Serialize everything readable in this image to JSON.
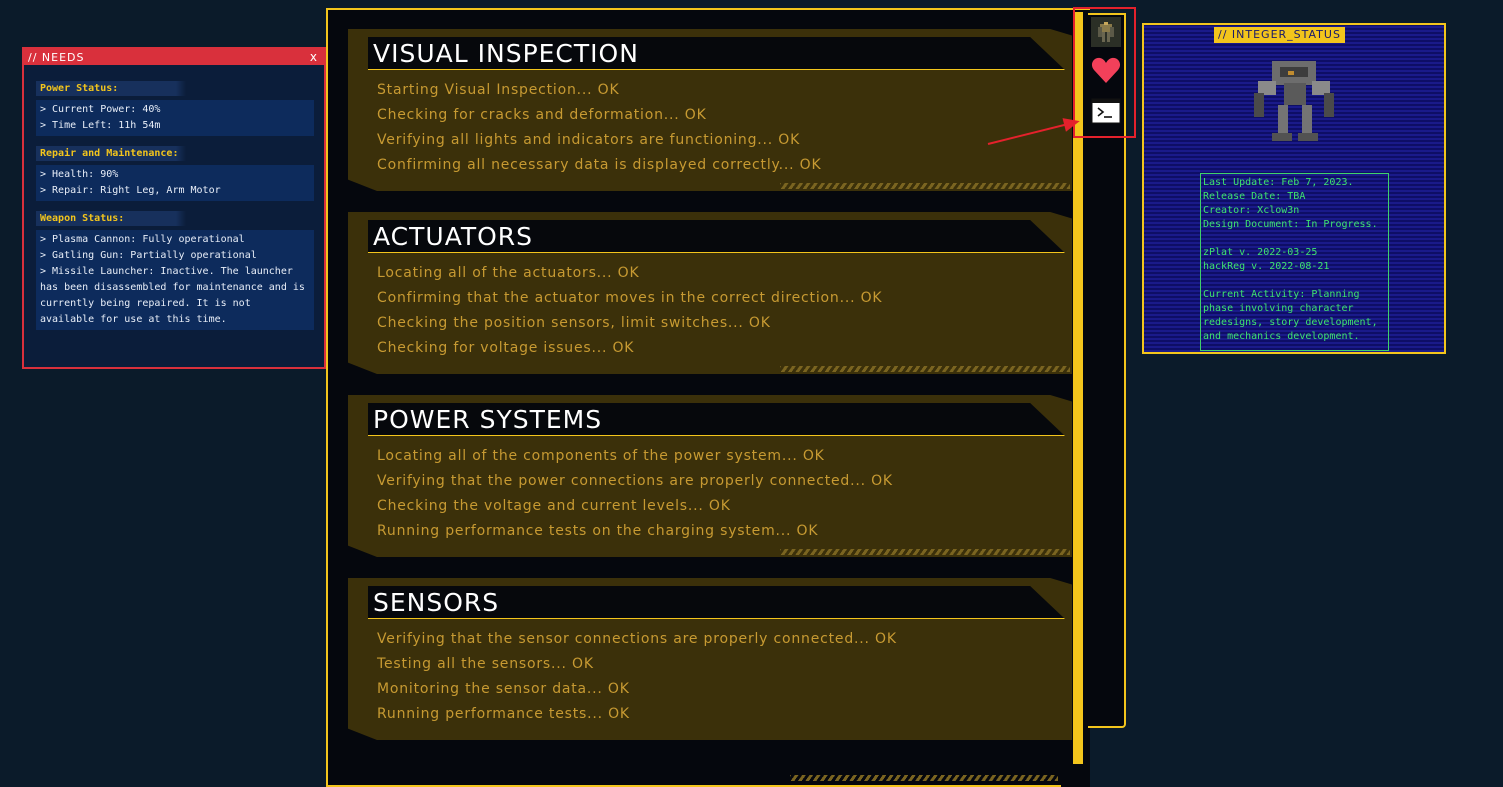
{
  "needs": {
    "title": "// NEEDS",
    "close": "x",
    "sections": [
      {
        "title": "Power Status:",
        "lines": [
          "> Current Power: 40%",
          "> Time Left: 11h 54m"
        ]
      },
      {
        "title": "Repair and Maintenance:",
        "lines": [
          "> Health: 90%",
          "> Repair: Right Leg, Arm Motor"
        ]
      },
      {
        "title": "Weapon Status:",
        "lines": [
          "> Plasma Cannon: Fully operational",
          "> Gatling Gun: Partially operational",
          "> Missile Launcher: Inactive. The launcher has been disassembled for maintenance and is currently being repaired. It is not available for use at this time."
        ]
      }
    ]
  },
  "checklist": [
    {
      "title": "VISUAL INSPECTION",
      "lines": [
        "Starting Visual Inspection... OK",
        "Checking for cracks and deformation... OK",
        "Verifying all lights and indicators are functioning... OK",
        "Confirming all necessary data is displayed correctly... OK"
      ]
    },
    {
      "title": "ACTUATORS",
      "lines": [
        "Locating all of the actuators... OK",
        "Confirming that the actuator moves in the correct direction... OK",
        "Checking the position sensors, limit switches... OK",
        "Checking for voltage issues... OK"
      ]
    },
    {
      "title": "POWER SYSTEMS",
      "lines": [
        "Locating all of the components of the power system... OK",
        "Verifying that the power connections are properly connected... OK",
        "Checking the voltage and current levels... OK",
        "Running performance tests on the charging system... OK"
      ]
    },
    {
      "title": "SENSORS",
      "lines": [
        "Verifying that the sensor connections are properly connected... OK",
        "Testing all the sensors... OK",
        "Monitoring the sensor data... OK",
        "Running performance tests... OK"
      ]
    }
  ],
  "toolbar": {
    "icons": [
      "mech-avatar-icon",
      "heart-icon",
      "terminal-icon"
    ]
  },
  "status": {
    "badge": "// INTEGER_STATUS",
    "info": [
      "Last Update: Feb 7, 2023.",
      "Release Date: TBA",
      "Creator: Xclow3n",
      "Design Document: In Progress.",
      "",
      "zPlat v. 2022-03-25",
      "hackReg v. 2022-08-21",
      "",
      "Current Activity: Planning phase involving character redesigns, story development, and mechanics development."
    ]
  },
  "colors": {
    "accent": "#f3c51c",
    "alert": "#d9303c",
    "ok_text": "#c79a32",
    "terminal_green": "#3fe36f"
  }
}
